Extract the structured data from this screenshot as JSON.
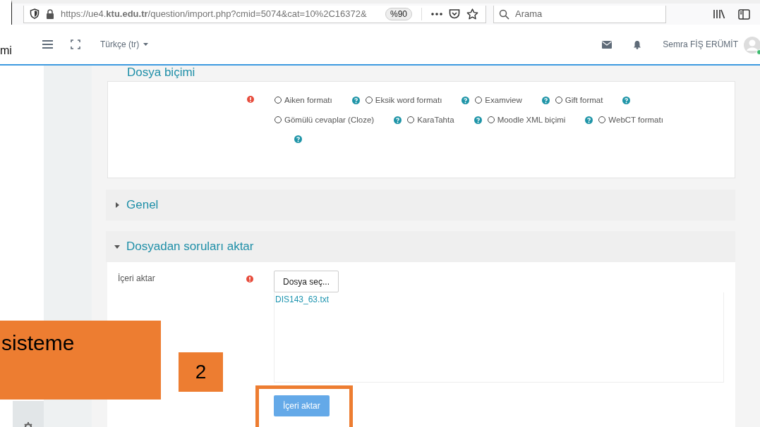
{
  "browser": {
    "url": "https://ue4.**ktu.edu.tr**/question/import.php?cmid=5074&cat=10%2C16372&",
    "zoom": "%90",
    "search": {
      "placeholder": "Arama"
    }
  },
  "navbar": {
    "brand_fragment": "mi",
    "language": "Türkçe (tr)",
    "user": "Semra FİŞ ERÜMİT"
  },
  "format_section": {
    "title": "Dosya biçimi",
    "options": [
      {
        "label": "Aiken formatı",
        "selected": false
      },
      {
        "label": "Eksik word formatı",
        "selected": false
      },
      {
        "label": "Examview",
        "selected": false
      },
      {
        "label": "Gift format",
        "selected": false
      },
      {
        "label": "Gömülü cevaplar (Cloze)",
        "selected": false
      },
      {
        "label": "KaraTahta",
        "selected": false
      },
      {
        "label": "Moodle XML biçimi",
        "selected": false
      },
      {
        "label": "WebCT formatı",
        "selected": false
      }
    ]
  },
  "sections": [
    {
      "title": "Genel",
      "expanded": false
    },
    {
      "title": "Dosyadan soruları aktar",
      "expanded": true,
      "field_label": "İçeri aktar",
      "choose_button": "Dosya seç...",
      "file": "DIS143_63.txt",
      "submit_button": "İçeri aktar"
    }
  ],
  "annotations": [
    {
      "text": "sisteme"
    },
    {
      "text": "2"
    }
  ]
}
